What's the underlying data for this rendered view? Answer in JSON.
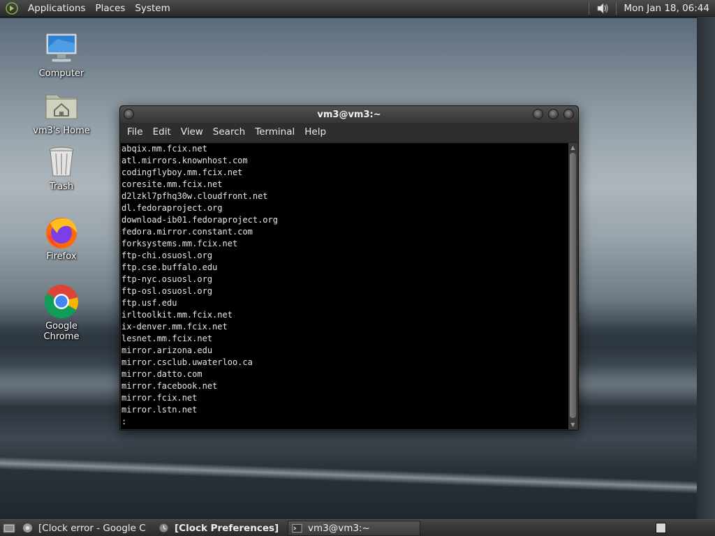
{
  "top_panel": {
    "menus": [
      "Applications",
      "Places",
      "System"
    ],
    "clock": "Mon Jan 18, 06:44",
    "volume_icon": "speaker-icon"
  },
  "desktop_icons": [
    {
      "label": "Computer",
      "icon": "computer-icon"
    },
    {
      "label": "vm3's Home",
      "icon": "home-folder-icon"
    },
    {
      "label": "Trash",
      "icon": "trash-icon"
    },
    {
      "label": "Firefox",
      "icon": "firefox-icon"
    },
    {
      "label": "Google Chrome",
      "icon": "chrome-icon"
    }
  ],
  "terminal": {
    "title": "vm3@vm3:~",
    "menus": [
      "File",
      "Edit",
      "View",
      "Search",
      "Terminal",
      "Help"
    ],
    "lines": [
      "abqix.mm.fcix.net",
      "atl.mirrors.knownhost.com",
      "codingflyboy.mm.fcix.net",
      "coresite.mm.fcix.net",
      "d2lzkl7pfhq30w.cloudfront.net",
      "dl.fedoraproject.org",
      "download-ib01.fedoraproject.org",
      "fedora.mirror.constant.com",
      "forksystems.mm.fcix.net",
      "ftp-chi.osuosl.org",
      "ftp.cse.buffalo.edu",
      "ftp-nyc.osuosl.org",
      "ftp-osl.osuosl.org",
      "ftp.usf.edu",
      "irltoolkit.mm.fcix.net",
      "ix-denver.mm.fcix.net",
      "lesnet.mm.fcix.net",
      "mirror.arizona.edu",
      "mirror.csclub.uwaterloo.ca",
      "mirror.datto.com",
      "mirror.facebook.net",
      "mirror.fcix.net",
      "mirror.lstn.net",
      ":"
    ]
  },
  "taskbar": {
    "tasks": [
      {
        "label": "[Clock error - Google Chr...",
        "icon": "chrome-icon",
        "active": false
      },
      {
        "label": "[Clock Preferences]",
        "icon": "clock-icon",
        "active": false
      },
      {
        "label": "vm3@vm3:~",
        "icon": "terminal-icon",
        "active": true
      }
    ]
  }
}
